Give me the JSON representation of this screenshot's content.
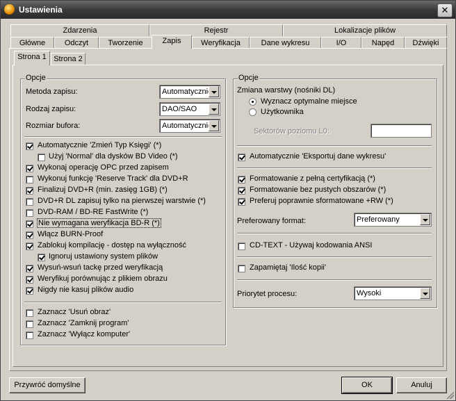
{
  "window": {
    "title": "Ustawienia"
  },
  "tabs_row_back": [
    "Zdarzenia",
    "Rejestr",
    "Lokalizacje plików"
  ],
  "tabs_row_front": [
    "Główne",
    "Odczyt",
    "Tworzenie",
    "Zapis",
    "Weryfikacja",
    "Dane wykresu",
    "I/O",
    "Napęd",
    "Dźwięki"
  ],
  "active_tab": "Zapis",
  "subtabs": [
    "Strona 1",
    "Strona 2"
  ],
  "left_group": {
    "label": "Opcje",
    "write_method": {
      "label": "Metoda zapisu:",
      "value": "Automatycznie"
    },
    "write_type": {
      "label": "Rodzaj zapisu:",
      "value": "DAO/SAO"
    },
    "buffer_size": {
      "label": "Rozmiar bufora:",
      "value": "Automatycznie"
    },
    "checkboxes": [
      {
        "label": "Automatycznie 'Zmień Typ Księgi' (*)",
        "checked": true
      },
      {
        "label": "Użyj 'Normal' dla dysków BD Video (*)",
        "checked": false
      },
      {
        "label": "Wykonaj operację OPC przed zapisem",
        "checked": true
      },
      {
        "label": "Wykonuj funkcję 'Reserve Track' dla DVD+R",
        "checked": false
      },
      {
        "label": "Finalizuj DVD+R (min. zasięg 1GB) (*)",
        "checked": true
      },
      {
        "label": "DVD+R DL zapisuj tylko na pierwszej warstwie (*)",
        "checked": false
      },
      {
        "label": "DVD-RAM / BD-RE FastWrite (*)",
        "checked": false
      },
      {
        "label": "Nie wymagana weryfikacja BD-R (*)",
        "checked": true
      },
      {
        "label": "Włącz BURN-Proof",
        "checked": true
      },
      {
        "label": "Zablokuj kompilację - dostęp na wyłączność",
        "checked": true
      },
      {
        "label": "Ignoruj ustawiony system plików",
        "checked": true
      },
      {
        "label": "Wysuń-wsuń tackę przed weryfikacją",
        "checked": true
      },
      {
        "label": "Weryfikuj porównując z plikiem obrazu",
        "checked": true
      },
      {
        "label": "Nigdy nie kasuj plików audio",
        "checked": true
      }
    ],
    "after_checkboxes": [
      {
        "label": "Zaznacz 'Usuń obraz'",
        "checked": false
      },
      {
        "label": "Zaznacz 'Zamknij program'",
        "checked": false
      },
      {
        "label": "Zaznacz 'Wyłącz komputer'",
        "checked": false
      }
    ]
  },
  "right_group": {
    "label": "Opcje",
    "layer_change": {
      "label": "Zmiana warstwy (nośniki DL)",
      "options": [
        {
          "label": "Wyznacz optymalne miejsce",
          "checked": true
        },
        {
          "label": "Użytkownika",
          "checked": false
        }
      ]
    },
    "l0_sectors": {
      "label": "Sektorów poziomu L0:",
      "value": ""
    },
    "auto_export": {
      "label": "Automatycznie 'Eksportuj dane wykresu'",
      "checked": true
    },
    "format_checks": [
      {
        "label": "Formatowanie z pełną certyfikacją (*)",
        "checked": true
      },
      {
        "label": "Formatowanie bez pustych obszarów (*)",
        "checked": true
      },
      {
        "label": "Preferuj poprawnie sformatowane +RW (*)",
        "checked": true
      }
    ],
    "preferred_format": {
      "label": "Preferowany format:",
      "value": "Preferowany"
    },
    "cd_text": {
      "label": "CD-TEXT - Używaj kodowania ANSI",
      "checked": false
    },
    "remember_copies": {
      "label": "Zapamiętaj 'Ilość kopii'",
      "checked": false
    },
    "priority": {
      "label": "Priorytet procesu:",
      "value": "Wysoki"
    }
  },
  "buttons": {
    "restore": "Przywróć domyślne",
    "ok": "OK",
    "cancel": "Anuluj"
  }
}
